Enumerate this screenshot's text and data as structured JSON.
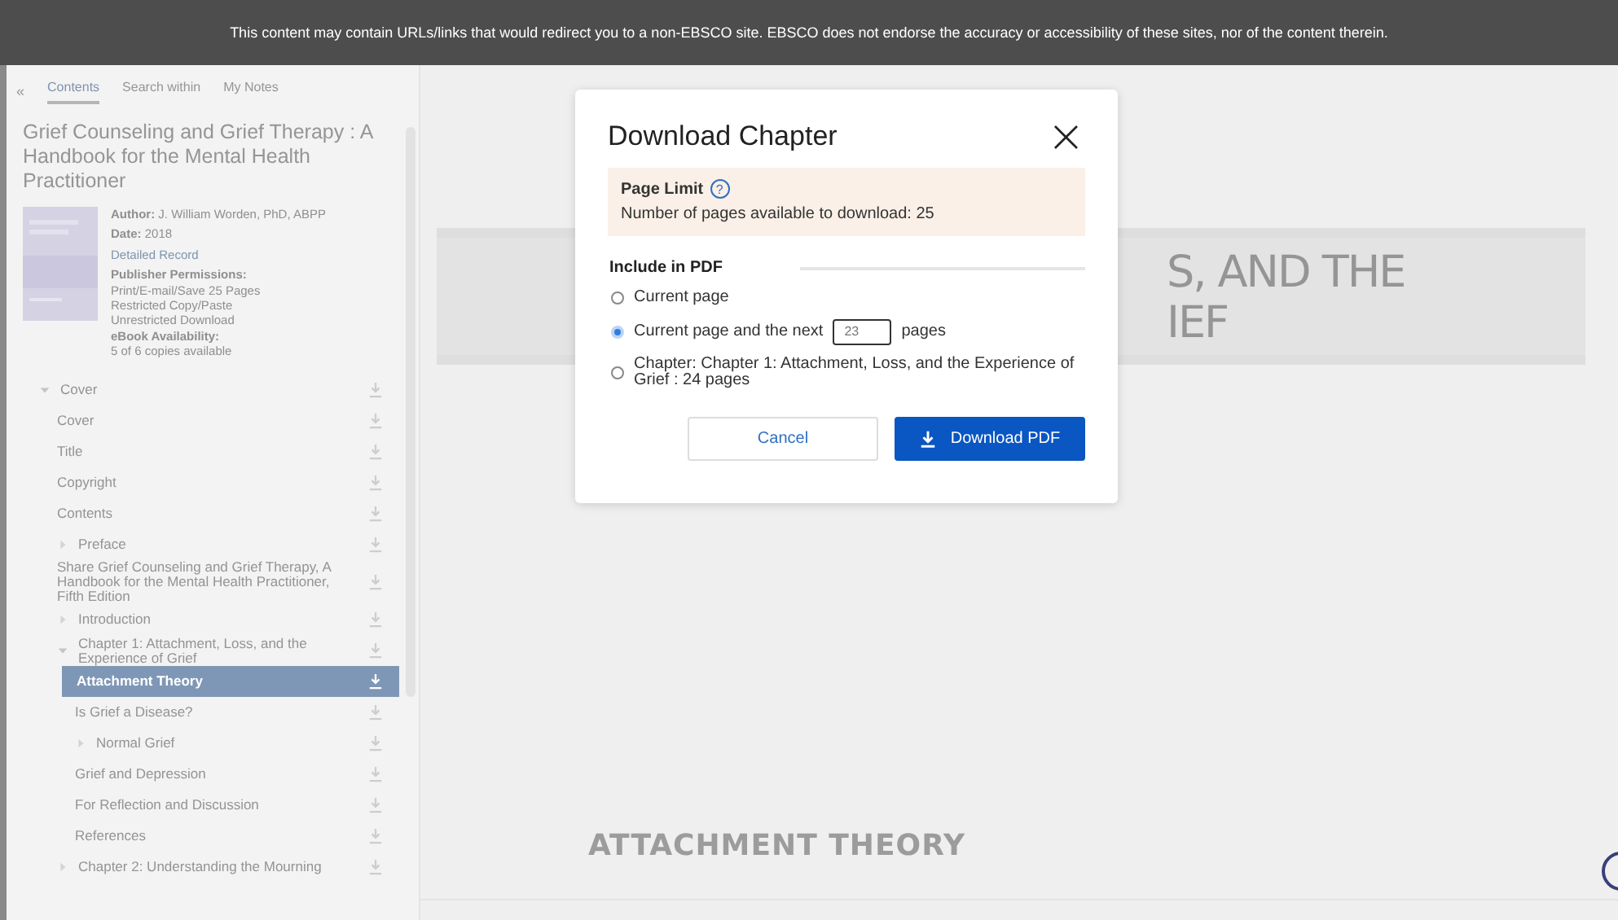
{
  "banner": {
    "text": "This content may contain URLs/links that would redirect you to a non-EBSCO site. EBSCO does not endorse the accuracy or accessibility of these sites, nor of the content therein."
  },
  "sidebar": {
    "collapse": "«",
    "tabs": [
      {
        "label": "Contents",
        "selected": true
      },
      {
        "label": "Search within",
        "selected": false
      },
      {
        "label": "My Notes",
        "selected": false
      }
    ],
    "title": "Grief Counseling and Grief Therapy : A Handbook for the Mental Health Practitioner",
    "meta": [
      {
        "kind": "line",
        "text": "**Author:** J. William Worden, PhD, ABPP"
      },
      {
        "kind": "line",
        "text": "**Date:** 2018"
      },
      {
        "kind": "link",
        "text": "Detailed Record"
      },
      {
        "kind": "heading",
        "text": "Publisher Permissions:"
      },
      {
        "kind": "plain",
        "text": "Print/E-mail/Save 25 Pages"
      },
      {
        "kind": "plain",
        "text": "Restricted Copy/Paste"
      },
      {
        "kind": "plain",
        "text": "Unrestricted Download"
      },
      {
        "kind": "heading",
        "text": "eBook Availability:"
      },
      {
        "kind": "plain",
        "text": "5 of 6 copies available"
      }
    ],
    "toc": [
      {
        "label": "Cover",
        "expanded": true,
        "selected": false,
        "children": [
          {
            "label": "Cover",
            "selected": false
          },
          {
            "label": "Title",
            "selected": false
          },
          {
            "label": "Copyright",
            "selected": false
          },
          {
            "label": "Contents",
            "selected": false
          },
          {
            "label": "Preface",
            "expanded": false,
            "selected": false
          },
          {
            "label": "Share Grief Counseling and Grief Therapy, A Handbook for the Mental Health Practitioner, Fifth Edition",
            "selected": false
          },
          {
            "label": "Introduction",
            "expanded": false,
            "selected": false
          },
          {
            "label": "Chapter 1: Attachment, Loss, and the Experience of Grief",
            "expanded": true,
            "selected": false,
            "children": [
              {
                "label": "Attachment Theory",
                "selected": true
              },
              {
                "label": "Is Grief a Disease?",
                "selected": false
              },
              {
                "label": "Normal Grief",
                "expanded": false,
                "selected": false
              },
              {
                "label": "Grief and Depression",
                "selected": false
              },
              {
                "label": "For Reflection and Discussion",
                "selected": false
              },
              {
                "label": "References",
                "selected": false
              }
            ]
          },
          {
            "label": "Chapter 2: Understanding the Mourning",
            "expanded": false,
            "selected": false
          }
        ]
      }
    ]
  },
  "page": {
    "chapter_heading": [
      "S, AND THE",
      "IEF"
    ],
    "section_heading": "ATTACHMENT THEORY"
  },
  "dialog": {
    "title": "Download Chapter",
    "close": "×",
    "notice": {
      "title": "Page Limit",
      "help": "?",
      "text": "Number of pages available to download: 25"
    },
    "section": "Include in PDF",
    "options": [
      {
        "kind": "plain",
        "label": "Current page",
        "selected": false
      },
      {
        "kind": "pages_input",
        "label": "Current page and the next",
        "value": "23",
        "suffix": "pages",
        "selected": true
      },
      {
        "kind": "plain",
        "label": "Chapter: Chapter 1: Attachment, Loss, and the Experience of Grief : 24 pages",
        "selected": false
      }
    ],
    "buttons": [
      {
        "kind": "secondary",
        "label": "Cancel"
      },
      {
        "kind": "primary",
        "label": "Download PDF"
      }
    ]
  }
}
